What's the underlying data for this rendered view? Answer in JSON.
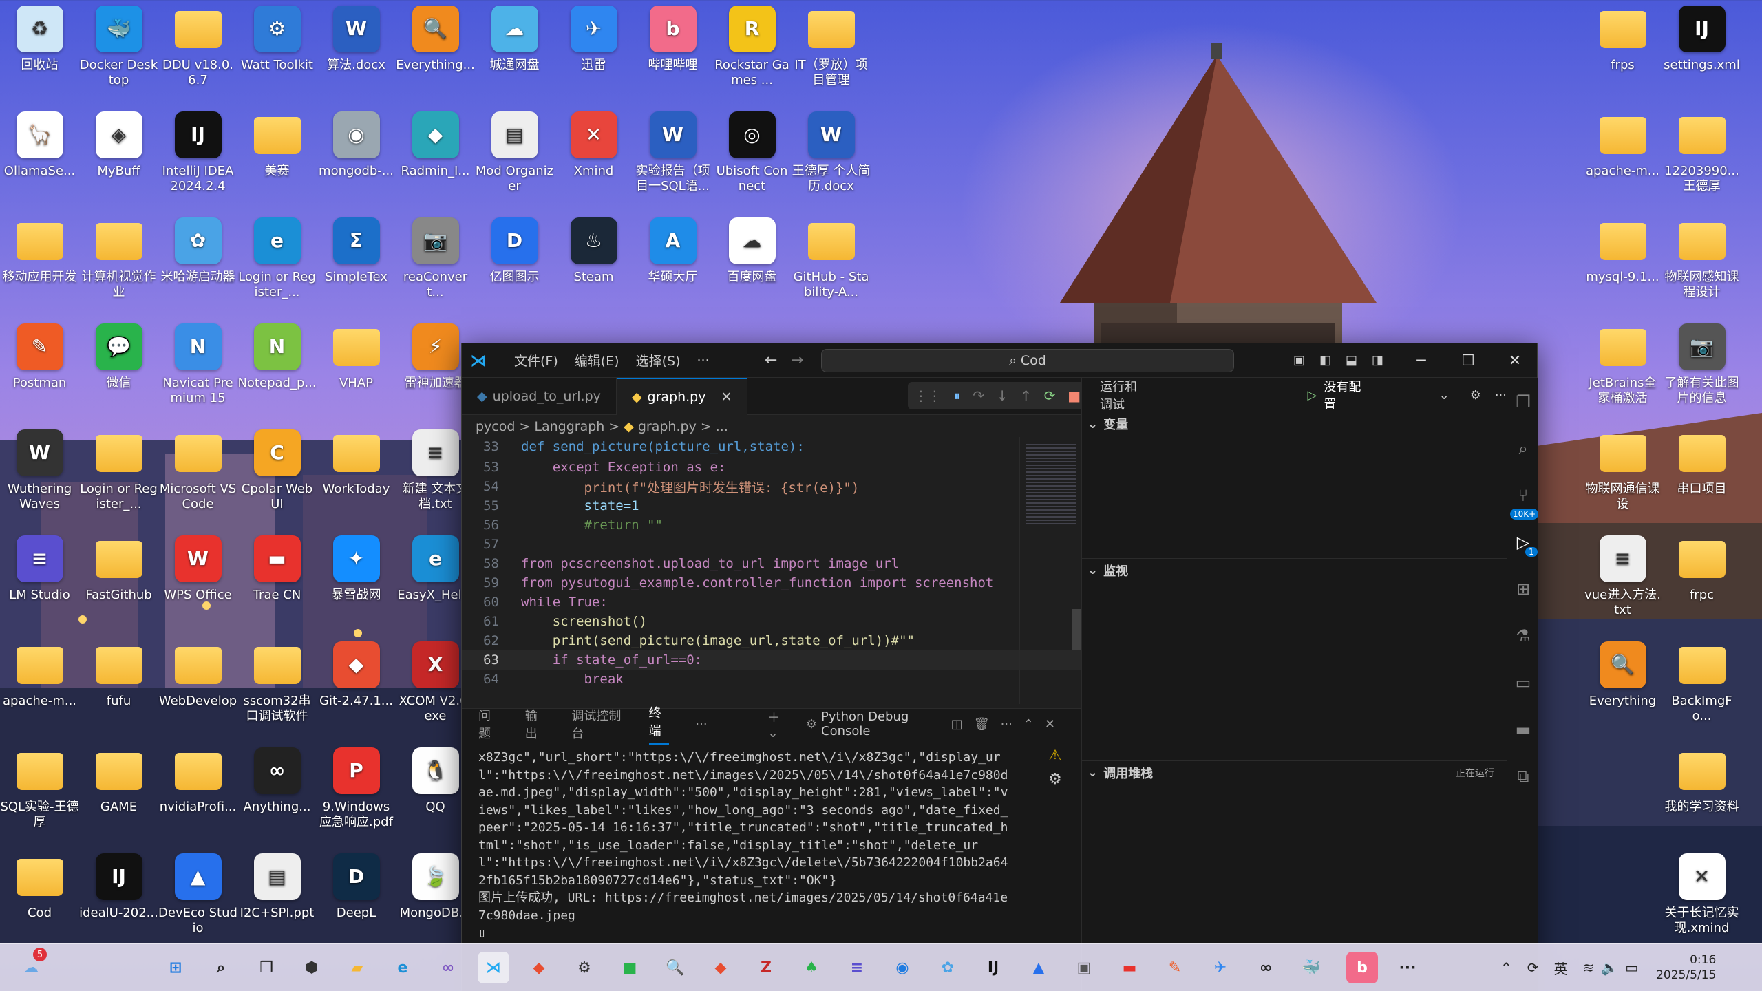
{
  "desktop": {
    "icons": [
      {
        "label": "回收站",
        "kind": "app",
        "color": "#cfe7f7",
        "glyph": "♻"
      },
      {
        "label": "Docker Desktop",
        "kind": "app",
        "color": "#1d91e6",
        "glyph": "🐳"
      },
      {
        "label": "DDU v18.0.6.7",
        "kind": "folder"
      },
      {
        "label": "Watt Toolkit",
        "kind": "app",
        "color": "#2f7bd8",
        "glyph": "⚙"
      },
      {
        "label": "算法.docx",
        "kind": "app",
        "color": "#2b5fc1",
        "glyph": "W"
      },
      {
        "label": "Everything...",
        "kind": "app",
        "color": "#f08a1e",
        "glyph": "🔍"
      },
      {
        "label": "城通网盘",
        "kind": "app",
        "color": "#4db2e8",
        "glyph": "☁"
      },
      {
        "label": "迅雷",
        "kind": "app",
        "color": "#2f86f0",
        "glyph": "✈"
      },
      {
        "label": "哔哩哔哩",
        "kind": "app",
        "color": "#f26b8a",
        "glyph": "b"
      },
      {
        "label": "Rockstar Games ...",
        "kind": "app",
        "color": "#f3c318",
        "glyph": "R"
      },
      {
        "label": "IT（罗放）项目管理",
        "kind": "folder"
      },
      {
        "label": "frps",
        "kind": "folder"
      },
      {
        "label": "settings.xml",
        "kind": "app",
        "color": "#111",
        "glyph": "IJ"
      },
      {
        "label": "OllamaSe...",
        "kind": "app",
        "color": "#fff",
        "glyph": "🦙"
      },
      {
        "label": "MyBuff",
        "kind": "app",
        "color": "#fff",
        "glyph": "◈"
      },
      {
        "label": "IntelliJ IDEA 2024.2.4",
        "kind": "app",
        "color": "#111",
        "glyph": "IJ"
      },
      {
        "label": "美赛",
        "kind": "folder"
      },
      {
        "label": "mongodb-...",
        "kind": "app",
        "color": "#9aa7b1",
        "glyph": "◉"
      },
      {
        "label": "Radmin_I...",
        "kind": "app",
        "color": "#2aa6b8",
        "glyph": "◆"
      },
      {
        "label": "Mod Organizer",
        "kind": "app",
        "color": "#eee",
        "glyph": "▤"
      },
      {
        "label": "Xmind",
        "kind": "app",
        "color": "#e8453c",
        "glyph": "✕"
      },
      {
        "label": "实验报告（项目一SQL语...",
        "kind": "app",
        "color": "#2b5fc1",
        "glyph": "W"
      },
      {
        "label": "Ubisoft Connect",
        "kind": "app",
        "color": "#111",
        "glyph": "◎"
      },
      {
        "label": "王德厚 个人简历.docx",
        "kind": "app",
        "color": "#2b5fc1",
        "glyph": "W"
      },
      {
        "label": "apache-m...",
        "kind": "folder"
      },
      {
        "label": "12203990...王德厚",
        "kind": "folder"
      },
      {
        "label": "移动应用开发",
        "kind": "folder"
      },
      {
        "label": "计算机视觉作业",
        "kind": "folder"
      },
      {
        "label": "米哈游启动器",
        "kind": "app",
        "color": "#4aa3e6",
        "glyph": "✿"
      },
      {
        "label": "Login or Register_...",
        "kind": "app",
        "color": "#1b8fd6",
        "glyph": "e"
      },
      {
        "label": "SimpleTex",
        "kind": "app",
        "color": "#1c6fc9",
        "glyph": "Σ"
      },
      {
        "label": "reaConvert...",
        "kind": "app",
        "color": "#888",
        "glyph": "📷"
      },
      {
        "label": "亿图图示",
        "kind": "app",
        "color": "#2770ec",
        "glyph": "D"
      },
      {
        "label": "Steam",
        "kind": "app",
        "color": "#1b2838",
        "glyph": "♨"
      },
      {
        "label": "华硕大厅",
        "kind": "app",
        "color": "#1f8ce8",
        "glyph": "A"
      },
      {
        "label": "百度网盘",
        "kind": "app",
        "color": "#fff",
        "glyph": "☁"
      },
      {
        "label": "GitHub - Stability-A...",
        "kind": "folder"
      },
      {
        "label": "mysql-9.1...",
        "kind": "folder"
      },
      {
        "label": "物联网感知课程设计",
        "kind": "folder"
      },
      {
        "label": "Postman",
        "kind": "app",
        "color": "#ef5b25",
        "glyph": "✎"
      },
      {
        "label": "微信",
        "kind": "app",
        "color": "#29b34b",
        "glyph": "💬"
      },
      {
        "label": "Navicat Premium 15",
        "kind": "app",
        "color": "#3a8ee6",
        "glyph": "N"
      },
      {
        "label": "Notepad_p...",
        "kind": "app",
        "color": "#7cc242",
        "glyph": "N"
      },
      {
        "label": "VHAP",
        "kind": "folder"
      },
      {
        "label": "雷神加速器",
        "kind": "app",
        "color": "#f08a1e",
        "glyph": "⚡"
      },
      {
        "label": "JetBrains全家桶激活",
        "kind": "folder"
      },
      {
        "label": "了解有关此图片的信息",
        "kind": "app",
        "color": "#555",
        "glyph": "📷"
      },
      {
        "label": "Wuthering Waves",
        "kind": "app",
        "color": "#333",
        "glyph": "W"
      },
      {
        "label": "Login or Register_...",
        "kind": "folder"
      },
      {
        "label": "Microsoft VS Code",
        "kind": "folder"
      },
      {
        "label": "Cpolar Web UI",
        "kind": "app",
        "color": "#f5a623",
        "glyph": "C"
      },
      {
        "label": "WorkToday",
        "kind": "folder"
      },
      {
        "label": "新建 文本文档.txt",
        "kind": "app",
        "color": "#eee",
        "glyph": "≡"
      },
      {
        "label": "物联网通信课设",
        "kind": "folder"
      },
      {
        "label": "串口项目",
        "kind": "folder"
      },
      {
        "label": "LM Studio",
        "kind": "app",
        "color": "#5a4fcf",
        "glyph": "≡"
      },
      {
        "label": "FastGithub",
        "kind": "folder"
      },
      {
        "label": "WPS Office",
        "kind": "app",
        "color": "#e8322d",
        "glyph": "W"
      },
      {
        "label": "Trae CN",
        "kind": "app",
        "color": "#e8322d",
        "glyph": "▬"
      },
      {
        "label": "暴雪战网",
        "kind": "app",
        "color": "#148eff",
        "glyph": "✦"
      },
      {
        "label": "EasyX_Hel...",
        "kind": "app",
        "color": "#1b8fd6",
        "glyph": "e"
      },
      {
        "label": "vue进入方法.txt",
        "kind": "app",
        "color": "#eee",
        "glyph": "≡"
      },
      {
        "label": "frpc",
        "kind": "folder"
      },
      {
        "label": "apache-m...",
        "kind": "folder"
      },
      {
        "label": "fufu",
        "kind": "folder"
      },
      {
        "label": "WebDevelop",
        "kind": "folder"
      },
      {
        "label": "sscom32串口调试软件",
        "kind": "folder"
      },
      {
        "label": "Git-2.47.1...",
        "kind": "app",
        "color": "#e84d31",
        "glyph": "◆"
      },
      {
        "label": "XCOM V2.0.exe",
        "kind": "app",
        "color": "#c62828",
        "glyph": "X"
      },
      {
        "label": "Everything",
        "kind": "app",
        "color": "#f08a1e",
        "glyph": "🔍"
      },
      {
        "label": "BackImgFo...",
        "kind": "folder"
      },
      {
        "label": "SQL实验-王德厚",
        "kind": "folder"
      },
      {
        "label": "GAME",
        "kind": "folder"
      },
      {
        "label": "nvidiaProfi...",
        "kind": "folder"
      },
      {
        "label": "Anything...",
        "kind": "app",
        "color": "#222",
        "glyph": "∞"
      },
      {
        "label": "9.Windows 应急响应.pdf",
        "kind": "app",
        "color": "#e8322d",
        "glyph": "P"
      },
      {
        "label": "QQ",
        "kind": "app",
        "color": "#fff",
        "glyph": "🐧"
      },
      {
        "label": "我的学习资料",
        "kind": "folder"
      },
      {
        "label": "Cod",
        "kind": "folder"
      },
      {
        "label": "idealU-202...",
        "kind": "app",
        "color": "#111",
        "glyph": "IJ"
      },
      {
        "label": "DevEco Studio",
        "kind": "app",
        "color": "#2770ec",
        "glyph": "▲"
      },
      {
        "label": "I2C+SPI.ppt",
        "kind": "app",
        "color": "#eee",
        "glyph": "▤"
      },
      {
        "label": "DeepL",
        "kind": "app",
        "color": "#0f2b46",
        "glyph": "D"
      },
      {
        "label": "MongoDB...",
        "kind": "app",
        "color": "#fff",
        "glyph": "🍃"
      },
      {
        "label": "关于长记忆实现.xmind",
        "kind": "app",
        "color": "#fff",
        "glyph": "✕"
      }
    ]
  },
  "vscode": {
    "menu": [
      "文件(F)",
      "编辑(E)",
      "选择(S)",
      "···"
    ],
    "search": "Cod",
    "tabs": [
      {
        "label": "upload_to_url.py",
        "active": false
      },
      {
        "label": "graph.py",
        "active": true
      }
    ],
    "breadcrumb": [
      "pycod",
      ">",
      "Langgraph",
      ">",
      "graph.py",
      ">",
      "..."
    ],
    "code": {
      "l33": {
        "n": "33",
        "t": "def send_picture(picture_url,state):"
      },
      "l53": {
        "n": "53",
        "t": "    except Exception as e:"
      },
      "l54": {
        "n": "54",
        "t": "        print(f\"处理图片时发生错误: {str(e)}\")"
      },
      "l55": {
        "n": "55",
        "t": "        state=1"
      },
      "l56": {
        "n": "56",
        "t": "        #return \"\""
      },
      "l57": {
        "n": "57",
        "t": ""
      },
      "l58": {
        "n": "58",
        "t": "from pcscreenshot.upload_to_url import image_url"
      },
      "l59": {
        "n": "59",
        "t": "from pysutogui_example.controller_function import screenshot"
      },
      "l60": {
        "n": "60",
        "t": "while True:"
      },
      "l61": {
        "n": "61",
        "t": "    screenshot()"
      },
      "l62": {
        "n": "62",
        "t": "    print(send_picture(image_url,state_of_url))#\"\""
      },
      "l63": {
        "n": "63",
        "t": "    if state_of_url==0:"
      },
      "l64": {
        "n": "64",
        "t": "        break"
      }
    },
    "panel_tabs": [
      "问题",
      "输出",
      "调试控制台",
      "终端",
      "···"
    ],
    "terminal_title": "Python Debug Console",
    "terminal_text": "x8Z3gc\",\"url_short\":\"https:\\/\\/freeimghost.net\\/i\\/x8Z3gc\",\"display_url\":\"https:\\/\\/freeimghost.net\\/images\\/2025\\/05\\/14\\/shot0f64a41e7c980dae.md.jpeg\",\"display_width\":\"500\",\"display_height\":281,\"views_label\":\"views\",\"likes_label\":\"likes\",\"how_long_ago\":\"3 seconds ago\",\"date_fixed_peer\":\"2025-05-14 16:16:37\",\"title_truncated\":\"shot\",\"title_truncated_html\":\"shot\",\"is_use_loader\":false,\"display_title\":\"shot\",\"delete_url\":\"https:\\/\\/freeimghost.net\\/i\\/x8Z3gc\\/delete\\/5b7364222004f10bb2a642fb165f15b2ba18090727cd14e6\"},\"status_txt\":\"OK\"}\n图片上传成功, URL: https://freeimghost.net/images/2025/05/14/shot0f64a41e7c980dae.jpeg\n▯",
    "run_debug": "运行和调试",
    "no_config": "没有配置",
    "sections": {
      "variables": "变量",
      "watch": "监视",
      "callstack": "调用堆栈",
      "running": "正在运行"
    },
    "badge_10k": "10K+",
    "badge_1": "1"
  },
  "taskbar": {
    "weather_badge": "5",
    "tray_lang": "英",
    "time": "0:16",
    "date": "2025/5/15"
  }
}
